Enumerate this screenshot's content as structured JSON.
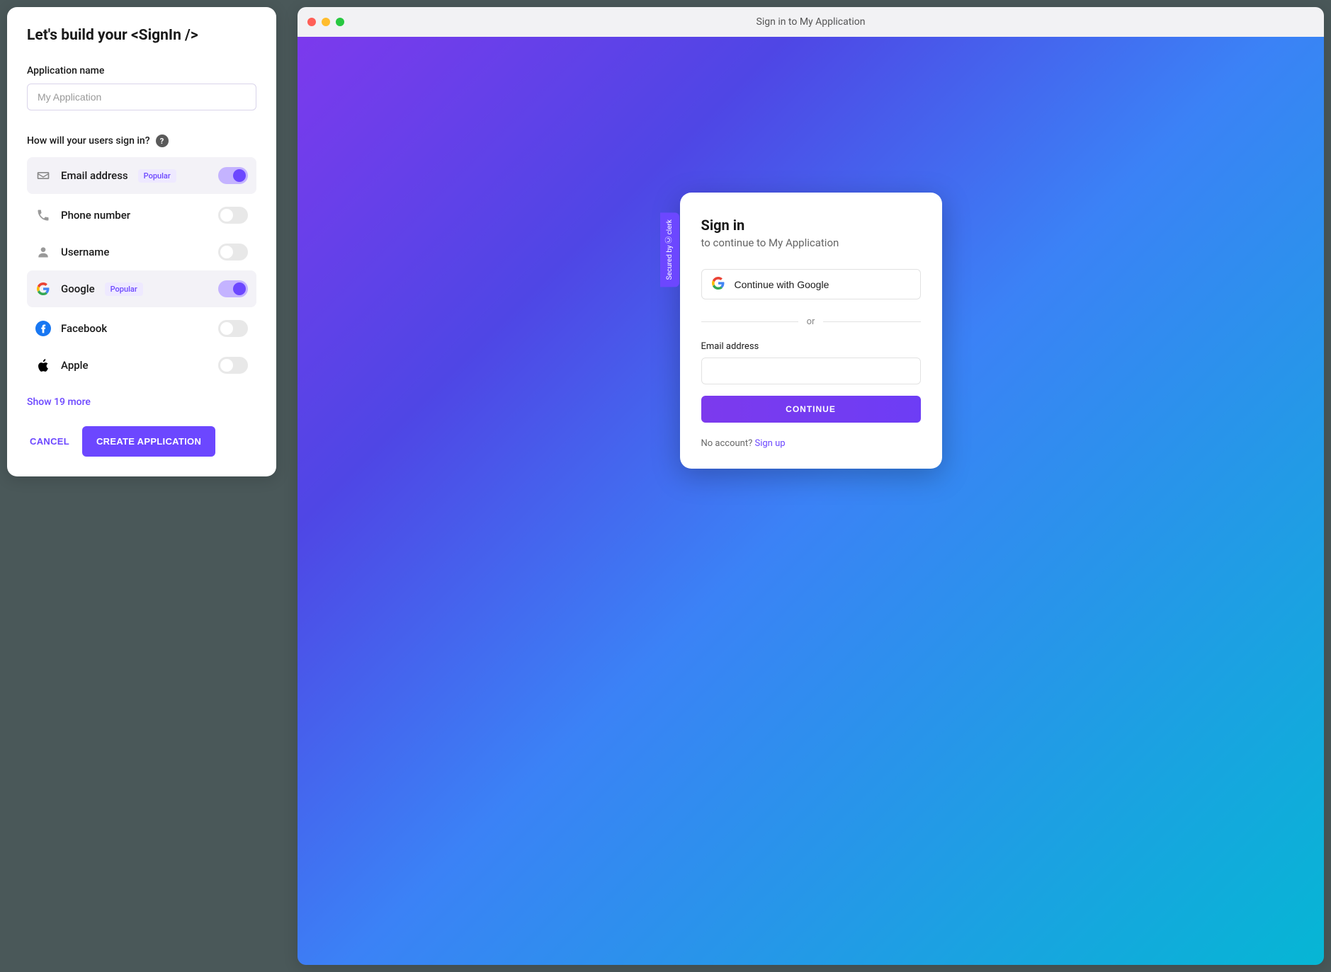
{
  "leftPanel": {
    "title": "Let's build your <SignIn />",
    "appNameLabel": "Application name",
    "appNamePlaceholder": "My Application",
    "howSignInLabel": "How will your users sign in?",
    "popularBadge": "Popular",
    "providers": {
      "email": "Email address",
      "phone": "Phone number",
      "username": "Username",
      "google": "Google",
      "facebook": "Facebook",
      "apple": "Apple"
    },
    "showMore": "Show 19 more",
    "cancel": "CANCEL",
    "create": "CREATE APPLICATION"
  },
  "windowTitle": "Sign in to My Application",
  "securedTab": "Secured by Ⓒ clerk",
  "signin": {
    "title": "Sign in",
    "subtitle": "to continue to My Application",
    "googleBtn": "Continue with Google",
    "divider": "or",
    "emailLabel": "Email address",
    "continue": "CONTINUE",
    "noAccount": "No account? ",
    "signup": "Sign up"
  }
}
